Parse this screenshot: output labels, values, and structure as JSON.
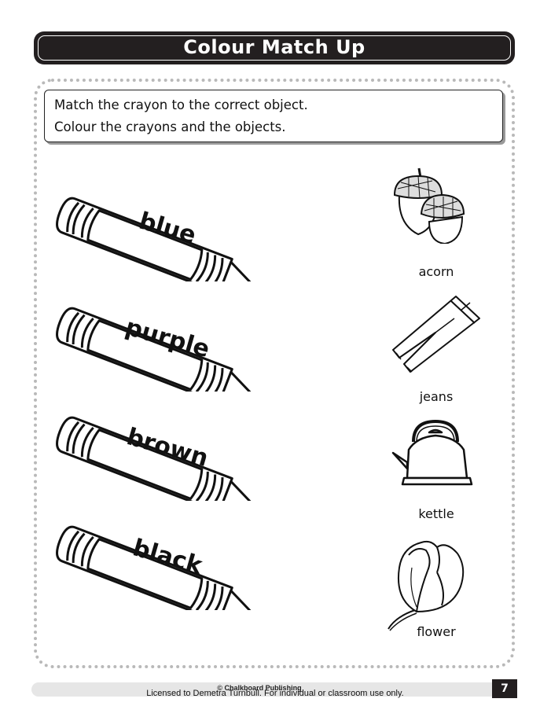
{
  "title": "Colour Match Up",
  "instructions": {
    "line1": "Match the crayon to the correct object.",
    "line2": "Colour the crayons and the objects."
  },
  "crayons": [
    {
      "word": "blue"
    },
    {
      "word": "purple"
    },
    {
      "word": "brown"
    },
    {
      "word": "black"
    }
  ],
  "objects": [
    {
      "label": "acorn",
      "icon": "acorn-icon"
    },
    {
      "label": "jeans",
      "icon": "jeans-icon"
    },
    {
      "label": "kettle",
      "icon": "kettle-icon"
    },
    {
      "label": "flower",
      "icon": "tulip-icon"
    }
  ],
  "footer": {
    "copyright": "© Chalkboard Publishing",
    "license": "Licensed to Demetra Turnbull. For individual or classroom use only.",
    "page_number": "7"
  }
}
